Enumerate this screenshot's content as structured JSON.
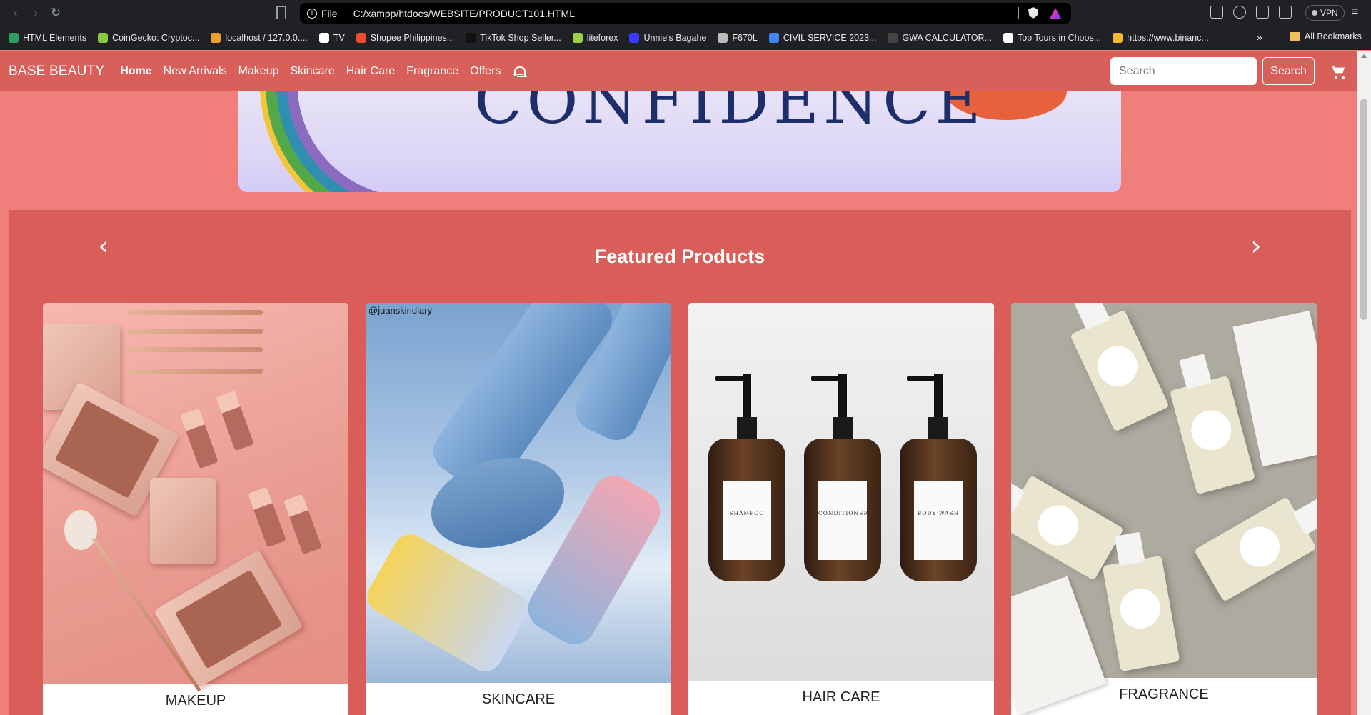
{
  "browser": {
    "address_info": "File",
    "url": "C:/xampp/htdocs/WEBSITE/PRODUCT101.HTML",
    "vpn_label": "VPN",
    "bookmarks": [
      {
        "label": "HTML Elements",
        "color": "#2e9e5b"
      },
      {
        "label": "CoinGecko: Cryptoc...",
        "color": "#8dc63f"
      },
      {
        "label": "localhost / 127.0.0....",
        "color": "#f0a030"
      },
      {
        "label": "TV",
        "color": "#ffffff"
      },
      {
        "label": "Shopee Philippines...",
        "color": "#ee4d2d"
      },
      {
        "label": "TikTok Shop Seller...",
        "color": "#111111"
      },
      {
        "label": "liteforex",
        "color": "#9bd04a"
      },
      {
        "label": "Unnie's Bagahe",
        "color": "#3a3aff"
      },
      {
        "label": "F670L",
        "color": "#bbbbbb"
      },
      {
        "label": "CIVIL SERVICE 2023...",
        "color": "#4285f4"
      },
      {
        "label": "GWA CALCULATOR...",
        "color": "#444444"
      },
      {
        "label": "Top Tours in Choos...",
        "color": "#ffffff"
      },
      {
        "label": "https://www.binanc...",
        "color": "#f3ba2f"
      }
    ],
    "all_bookmarks": "All Bookmarks"
  },
  "site": {
    "brand": "BASE BEAUTY",
    "nav": [
      "Home",
      "New Arrivals",
      "Makeup",
      "Skincare",
      "Hair Care",
      "Fragrance",
      "Offers"
    ],
    "search_placeholder": "Search",
    "search_button": "Search"
  },
  "hero": {
    "word": "CONFIDENCE"
  },
  "featured": {
    "title": "Featured Products",
    "prev": "‹",
    "next": "›",
    "products": [
      {
        "label": "MAKEUP"
      },
      {
        "label": "SKINCARE",
        "watermark": "@juanskindiary"
      },
      {
        "label": "HAIR CARE",
        "bottle_labels": [
          "SHAMPOO",
          "CONDITIONER",
          "BODY WASH"
        ]
      },
      {
        "label": "FRAGRANCE"
      }
    ]
  }
}
